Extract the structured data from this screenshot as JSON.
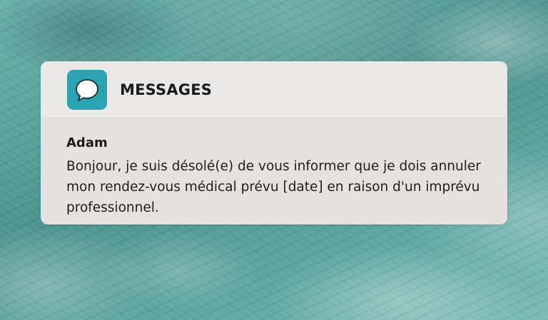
{
  "notification": {
    "app_icon": "speech-bubble-icon",
    "app_name": "MESSAGES",
    "sender": "Adam",
    "message": "Bonjour, je suis désolé(e) de vous informer que je dois annuler mon rendez-vous médical prévu [date] en raison d'un imprévu professionnel.",
    "colors": {
      "icon_background": "#2aa3b3",
      "card_background": "#e4e1df",
      "header_background": "#ebe9e7"
    }
  },
  "background": {
    "description_icon": "ocean-water-texture"
  }
}
